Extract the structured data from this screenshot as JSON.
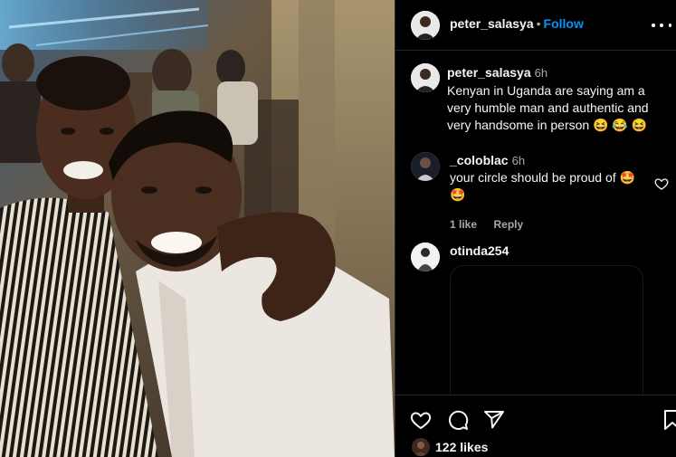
{
  "post": {
    "author": "peter_salasya",
    "separator": "•",
    "follow_label": "Follow",
    "caption": {
      "author": "peter_salasya",
      "time": "6h",
      "text": "Kenyan in Uganda are saying am a very humble man and authentic and very handsome in person 😆 😂 😆"
    }
  },
  "comments": [
    {
      "user": "_coloblac",
      "time": "6h",
      "text": "your circle should be proud of 🤩 🤩",
      "likes": "1 like",
      "reply_label": "Reply"
    },
    {
      "user": "otinda254"
    }
  ],
  "actions": {
    "likes": "122 likes"
  },
  "colors": {
    "background": "#000000",
    "link": "#0095f6",
    "muted": "#a8a8a8",
    "divider": "#262626"
  },
  "icons": [
    "more-options-icon",
    "heart-icon",
    "comment-icon",
    "share-icon",
    "bookmark-icon"
  ]
}
